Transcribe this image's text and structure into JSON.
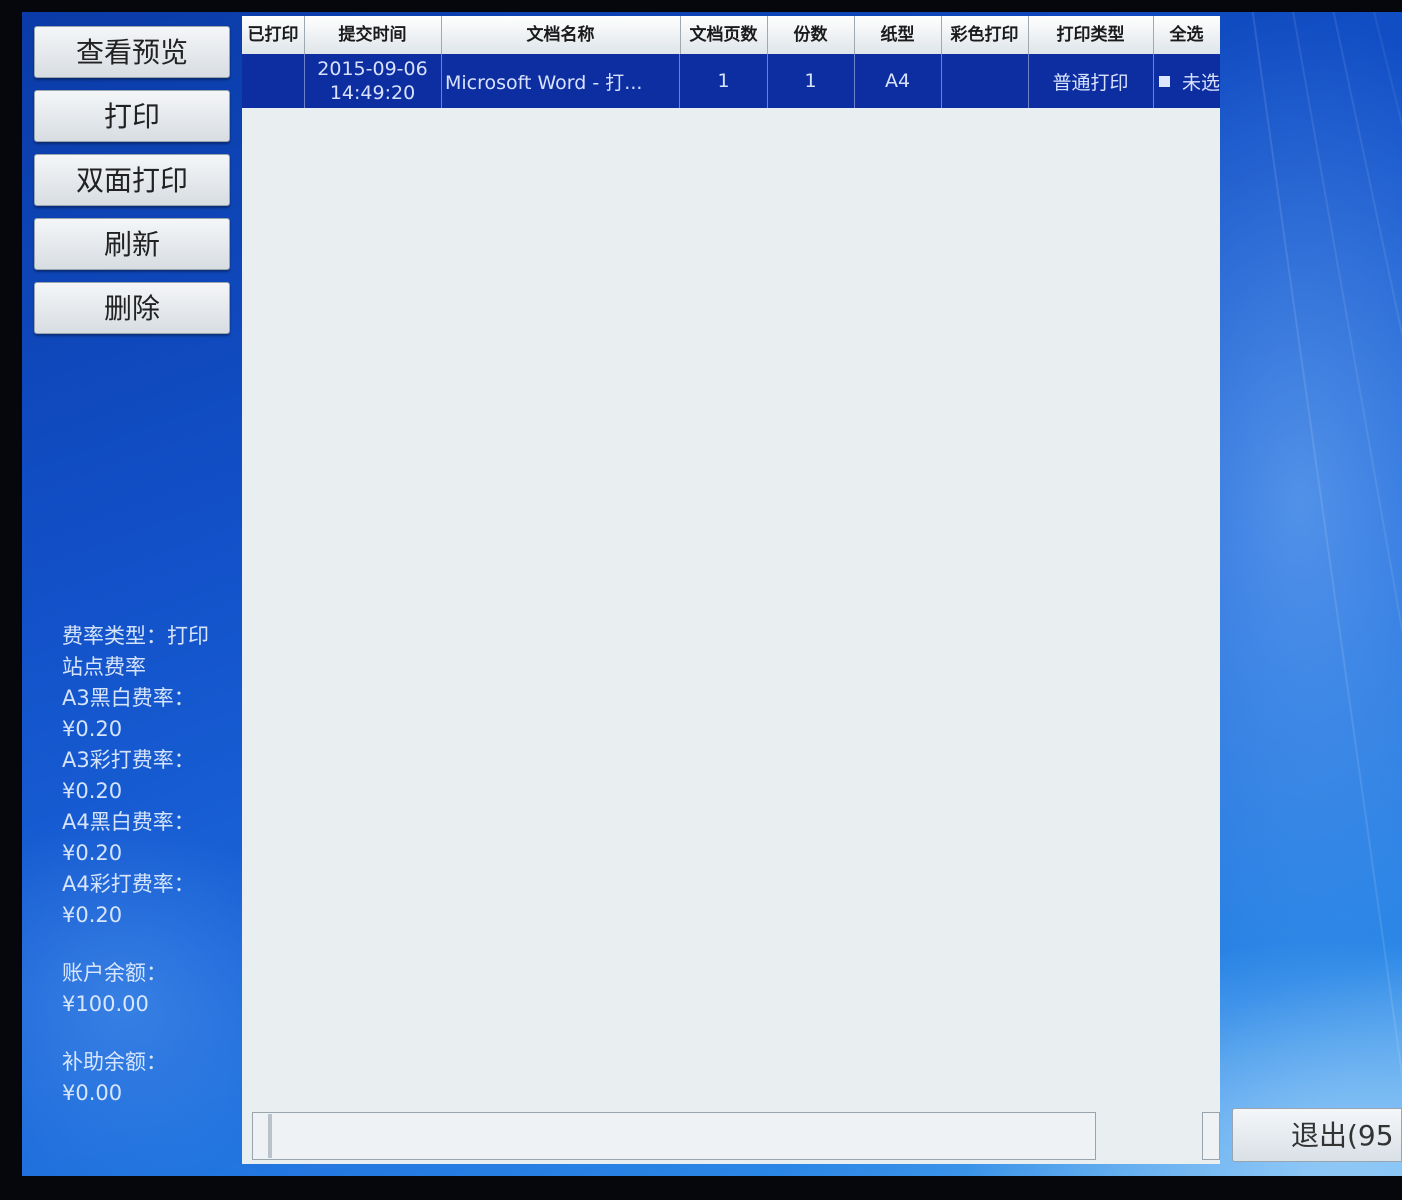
{
  "buttons": {
    "preview": "查看预览",
    "print": "打印",
    "duplex_print": "双面打印",
    "refresh": "刷新",
    "delete": "删除",
    "exit": "退出(95"
  },
  "info": {
    "rate_type": "费率类型：打印站点费率",
    "a3_bw_label": "A3黑白费率：",
    "a3_bw_value": "¥0.20",
    "a3_color_label": "A3彩打费率：",
    "a3_color_value": "¥0.20",
    "a4_bw_label": "A4黑白费率：",
    "a4_bw_value": "¥0.20",
    "a4_color_label": "A4彩打费率：",
    "a4_color_value": "¥0.20",
    "balance_label": "账户余额：",
    "balance_value": "¥100.00",
    "subsidy_label": "补助余额：",
    "subsidy_value": "¥0.00"
  },
  "table": {
    "headers": [
      "已打印",
      "提交时间",
      "文档名称",
      "文档页数",
      "份数",
      "纸型",
      "彩色打印",
      "打印类型",
      "全选"
    ],
    "rows": [
      {
        "printed": "",
        "date": "2015-09-06",
        "time": "14:49:20",
        "name": "Microsoft Word - 打...",
        "pages": "1",
        "copies": "1",
        "paper": "A4",
        "color": "",
        "type": "普通打印",
        "select": "未选"
      }
    ]
  },
  "colors": {
    "background_blue": "#1250c8",
    "row_selected": "#0d2ea0",
    "panel": "#e9eef1"
  }
}
